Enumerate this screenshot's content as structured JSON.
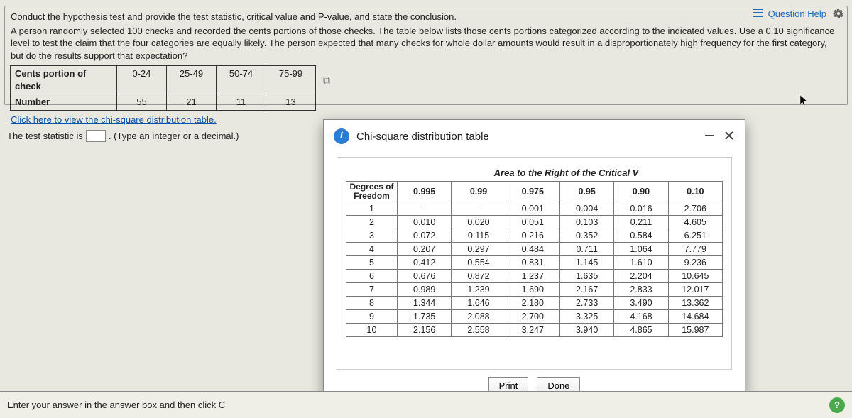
{
  "top": {
    "help_label": "Question Help"
  },
  "question": {
    "line1": "Conduct the hypothesis test and provide the test statistic, critical value and P-value, and state the conclusion.",
    "line2": "A person randomly selected 100 checks and recorded the cents portions of those checks. The table below lists those cents portions categorized according to the indicated values. Use a 0.10 significance level to test the claim that the four categories are equally likely. The person expected that many checks for whole dollar amounts would result in a disproportionately high frequency for the first category, but do the results support that expectation?",
    "data_table": {
      "row_head1": "Cents portion of check",
      "row_head2": "Number",
      "cats": [
        "0-24",
        "25-49",
        "50-74",
        "75-99"
      ],
      "nums": [
        "55",
        "21",
        "11",
        "13"
      ]
    },
    "link_text": "Click here to view the chi-square distribution table.",
    "stmt_before": "The test statistic is",
    "stmt_after": ". (Type an integer or a decimal.)"
  },
  "modal": {
    "title": "Chi-square distribution table",
    "area_caption": "Area to the Right of the Critical V",
    "df_head_l1": "Degrees of",
    "df_head_l2": "Freedom",
    "alphas": [
      "0.995",
      "0.99",
      "0.975",
      "0.95",
      "0.90",
      "0.10"
    ],
    "rows": [
      {
        "df": "1",
        "v": [
          "-",
          "-",
          "0.001",
          "0.004",
          "0.016",
          "2.706"
        ]
      },
      {
        "df": "2",
        "v": [
          "0.010",
          "0.020",
          "0.051",
          "0.103",
          "0.211",
          "4.605"
        ]
      },
      {
        "df": "3",
        "v": [
          "0.072",
          "0.115",
          "0.216",
          "0.352",
          "0.584",
          "6.251"
        ]
      },
      {
        "df": "4",
        "v": [
          "0.207",
          "0.297",
          "0.484",
          "0.711",
          "1.064",
          "7.779"
        ]
      },
      {
        "df": "5",
        "v": [
          "0.412",
          "0.554",
          "0.831",
          "1.145",
          "1.610",
          "9.236"
        ]
      },
      {
        "df": "6",
        "v": [
          "0.676",
          "0.872",
          "1.237",
          "1.635",
          "2.204",
          "10.645"
        ]
      },
      {
        "df": "7",
        "v": [
          "0.989",
          "1.239",
          "1.690",
          "2.167",
          "2.833",
          "12.017"
        ]
      },
      {
        "df": "8",
        "v": [
          "1.344",
          "1.646",
          "2.180",
          "2.733",
          "3.490",
          "13.362"
        ]
      },
      {
        "df": "9",
        "v": [
          "1.735",
          "2.088",
          "2.700",
          "3.325",
          "4.168",
          "14.684"
        ]
      },
      {
        "df": "10",
        "v": [
          "2.156",
          "2.558",
          "3.247",
          "3.940",
          "4.865",
          "15.987"
        ]
      }
    ],
    "print_label": "Print",
    "done_label": "Done"
  },
  "bottom": {
    "enter_prompt": "Enter your answer in the answer box and then click C"
  }
}
